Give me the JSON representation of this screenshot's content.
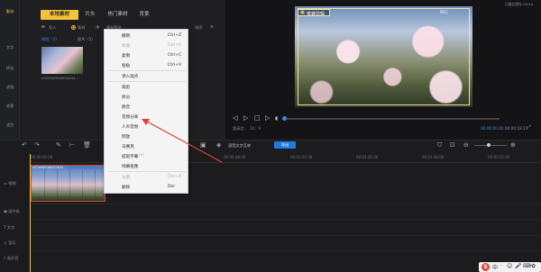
{
  "nav": {
    "items": [
      {
        "label": "素材",
        "active": true
      },
      {
        "label": "文字"
      },
      {
        "label": "转场"
      },
      {
        "label": "滤镜"
      },
      {
        "label": "遮罩"
      },
      {
        "label": "滤色"
      }
    ]
  },
  "media": {
    "tabs": [
      {
        "label": "本地素材",
        "active": true
      },
      {
        "label": "片头"
      },
      {
        "label": "热门素材"
      },
      {
        "label": "背景"
      }
    ],
    "import_label": "导入",
    "filter_all": "素材",
    "filter_selected": "素材筛选",
    "sort_label": "排序",
    "sub_tabs": [
      "视频（1）",
      "图片（1）"
    ],
    "file_name": "e02b50f5db550a34..."
  },
  "preview": {
    "logo_label": "蜜蜂剪辑",
    "top_right": "已最后保存 09:44",
    "ratio_label": "宽高比：",
    "ratio_value": "16：9",
    "time_current": "00:00:00.00",
    "time_total": "00:00:18.17",
    "rec_badge": "REC"
  },
  "context_menu": {
    "items": [
      {
        "label": "撤销",
        "shortcut": "Ctrl+Z",
        "disabled": false
      },
      {
        "label": "恢复",
        "shortcut": "Ctrl+Y",
        "disabled": true
      },
      {
        "label": "复制",
        "shortcut": "Ctrl+C",
        "disabled": false
      },
      {
        "label": "粘贴",
        "shortcut": "Ctrl+V",
        "disabled": false
      },
      {
        "label": "添入观点",
        "shortcut": "",
        "disabled": false
      },
      {
        "label": "裁剪",
        "shortcut": "",
        "disabled": false
      },
      {
        "label": "拆分",
        "shortcut": "",
        "disabled": false
      },
      {
        "label": "静音",
        "shortcut": "",
        "disabled": false
      },
      {
        "label": "音频分离",
        "shortcut": "",
        "disabled": false
      },
      {
        "label": "人声音频",
        "shortcut": "",
        "disabled": false
      },
      {
        "label": "倒放",
        "shortcut": "",
        "disabled": false
      },
      {
        "label": "马赛克",
        "shortcut": "",
        "disabled": false
      },
      {
        "label": "提取字幕",
        "shortcut": "",
        "disabled": false,
        "badge": "VIP"
      },
      {
        "label": "绿幕抠像",
        "shortcut": "",
        "disabled": false
      },
      {
        "label": "分割",
        "shortcut": "Ctrl+X",
        "disabled": true
      },
      {
        "label": "删除",
        "shortcut": "Del",
        "disabled": false
      }
    ]
  },
  "timeline": {
    "recognize_label": "语音文字互转",
    "export_label": "导出",
    "ruler": [
      "00:00:00.00",
      "00:00:48.00",
      "00:01:04.00",
      "00:01:20.00",
      "00:01:36.00",
      "00:01:52.00"
    ],
    "tracks": [
      "视频",
      "画中画",
      "文字",
      "音乐",
      "画外音"
    ],
    "clip_name": "e02b50f5db550a34..."
  },
  "ime": {
    "label": "S"
  },
  "colors": {
    "accent": "#f2c23a",
    "highlight": "#d9433a",
    "primary": "#1f7ae0"
  }
}
